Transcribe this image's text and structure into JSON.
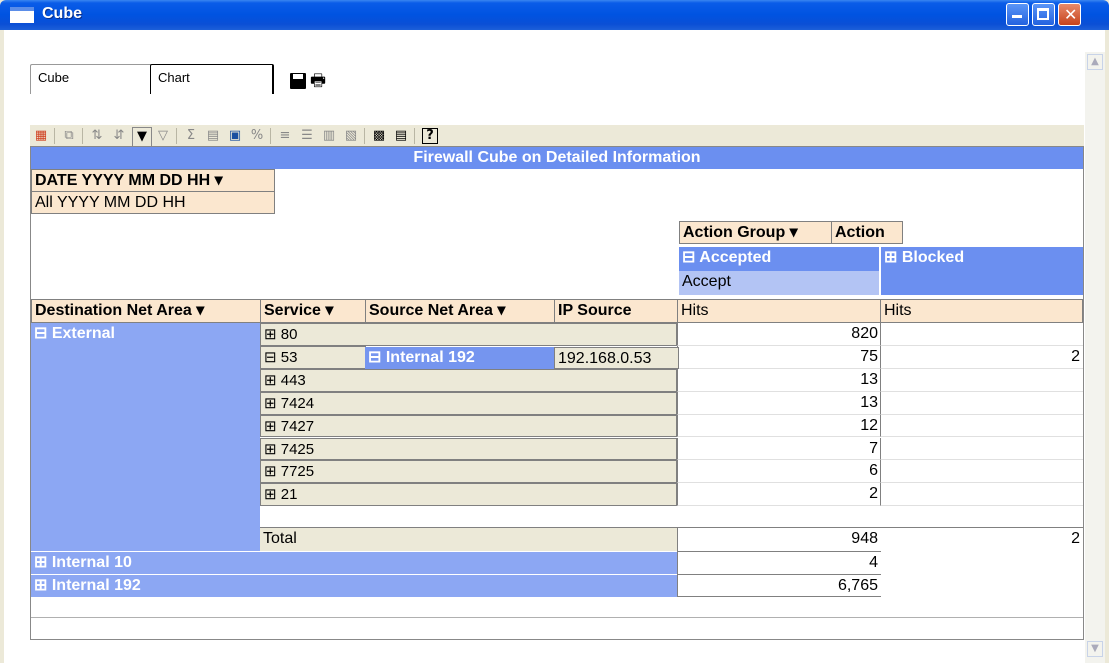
{
  "window": {
    "title": "Cube"
  },
  "tabs": [
    {
      "label": "Cube"
    },
    {
      "label": "Chart"
    }
  ],
  "toolbar_icons": [
    "cube-icon",
    "copy-icon",
    "sort-asc-icon",
    "sort-desc-icon",
    "filter-icon",
    "filter-off-icon",
    "sum-icon",
    "chart-icon",
    "calculator-icon",
    "percent-icon",
    "cols-icon",
    "rows-icon",
    "expand-icon",
    "collapse-icon",
    "export-icon",
    "notes-icon",
    "help-icon"
  ],
  "pivot": {
    "title": "Firewall Cube on Detailed Information",
    "filter_field": "DATE YYYY MM DD HH ▾",
    "filter_value": "All YYYY MM DD HH",
    "col_field_1": "Action Group ▾",
    "col_field_2": "Action",
    "col_accepted": "⊟ Accepted",
    "col_blocked": "⊞ Blocked",
    "col_accept": "Accept",
    "row_field_1": "Destination Net Area ▾",
    "row_field_2": "Service ▾",
    "row_field_3": "Source Net Area ▾",
    "row_field_4": "IP Source",
    "measure_1": "Hits",
    "measure_2": "Hits",
    "group_external": "⊟ External",
    "internal_192_source": "⊟ Internal 192",
    "ip_source_value": "192.168.0.53",
    "services": [
      {
        "label": "⊞ 80",
        "hits": "820",
        "blocked": ""
      },
      {
        "label": "⊟ 53",
        "hits": "75",
        "blocked": "2"
      },
      {
        "label": "⊞ 443",
        "hits": "13",
        "blocked": ""
      },
      {
        "label": "⊞ 7424",
        "hits": "13",
        "blocked": ""
      },
      {
        "label": "⊞ 7427",
        "hits": "12",
        "blocked": ""
      },
      {
        "label": "⊞ 7425",
        "hits": "7",
        "blocked": ""
      },
      {
        "label": "⊞ 7725",
        "hits": "6",
        "blocked": ""
      },
      {
        "label": "⊞ 21",
        "hits": "2",
        "blocked": ""
      }
    ],
    "total_label": "Total",
    "total_hits": "948",
    "total_blocked": "2",
    "group_internal_10": "⊞ Internal 10",
    "internal_10_hits": "4",
    "group_internal_192": "⊞ Internal 192",
    "internal_192_hits": "6,765"
  }
}
